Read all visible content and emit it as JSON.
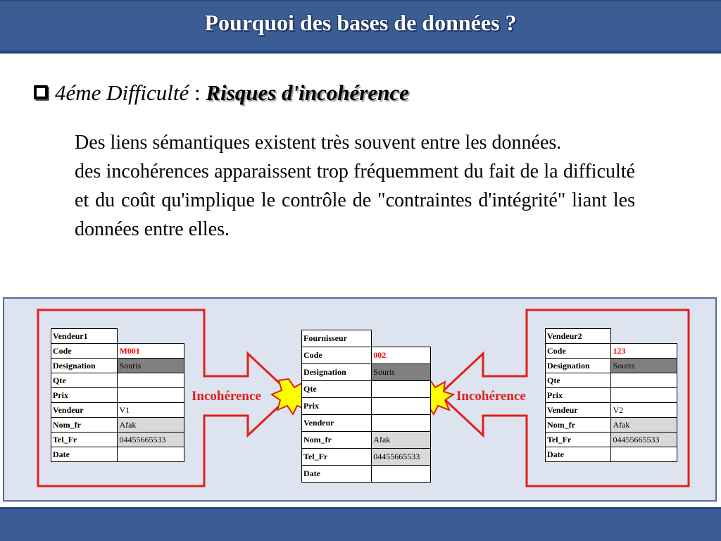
{
  "slide": {
    "title": "Pourquoi des bases de données ?",
    "heading_prefix": "4éme Difficulté",
    "heading_sep": " : ",
    "heading_emphasis": "Risques d'incohérence",
    "paragraph1": "Des liens sémantiques existent très souvent entre les données.",
    "paragraph2": "des incohérences apparaissent trop fréquemment du fait de la difficulté et du coût qu'implique le contrôle de \"contraintes d'intégrité\" liant les données entre elles."
  },
  "diagram": {
    "label_left": "Incohérence",
    "label_right": "Incohérence",
    "colors": {
      "alert_red": "#e0201c",
      "star_yellow": "#ffff00",
      "panel_bg": "#dde3ef"
    },
    "tables": [
      {
        "title": "Vendeur1",
        "rows": [
          {
            "k": "Code",
            "v": "M001"
          },
          {
            "k": "Designation",
            "v": "Souris"
          },
          {
            "k": "Qte",
            "v": ""
          },
          {
            "k": "Prix",
            "v": ""
          },
          {
            "k": "Vendeur",
            "v": "V1"
          },
          {
            "k": "Nom_fr",
            "v": "Afak"
          },
          {
            "k": "Tel_Fr",
            "v": "04455665533"
          },
          {
            "k": "Date",
            "v": ""
          }
        ]
      },
      {
        "title": "Fournisseur",
        "rows": [
          {
            "k": "Code",
            "v": "002"
          },
          {
            "k": "Designation",
            "v": "Souris"
          },
          {
            "k": "Qte",
            "v": ""
          },
          {
            "k": "Prix",
            "v": ""
          },
          {
            "k": "Vendeur",
            "v": ""
          },
          {
            "k": "Nom_fr",
            "v": "Afak"
          },
          {
            "k": "Tel_Fr",
            "v": "04455665533"
          },
          {
            "k": "Date",
            "v": ""
          }
        ]
      },
      {
        "title": "Vendeur2",
        "rows": [
          {
            "k": "Code",
            "v": "123"
          },
          {
            "k": "Designation",
            "v": "Souris"
          },
          {
            "k": "Qte",
            "v": ""
          },
          {
            "k": "Prix",
            "v": ""
          },
          {
            "k": "Vendeur",
            "v": "V2"
          },
          {
            "k": "Nom_fr",
            "v": "Afak"
          },
          {
            "k": "Tel_Fr",
            "v": "04455665533"
          },
          {
            "k": "Date",
            "v": ""
          }
        ]
      }
    ]
  }
}
